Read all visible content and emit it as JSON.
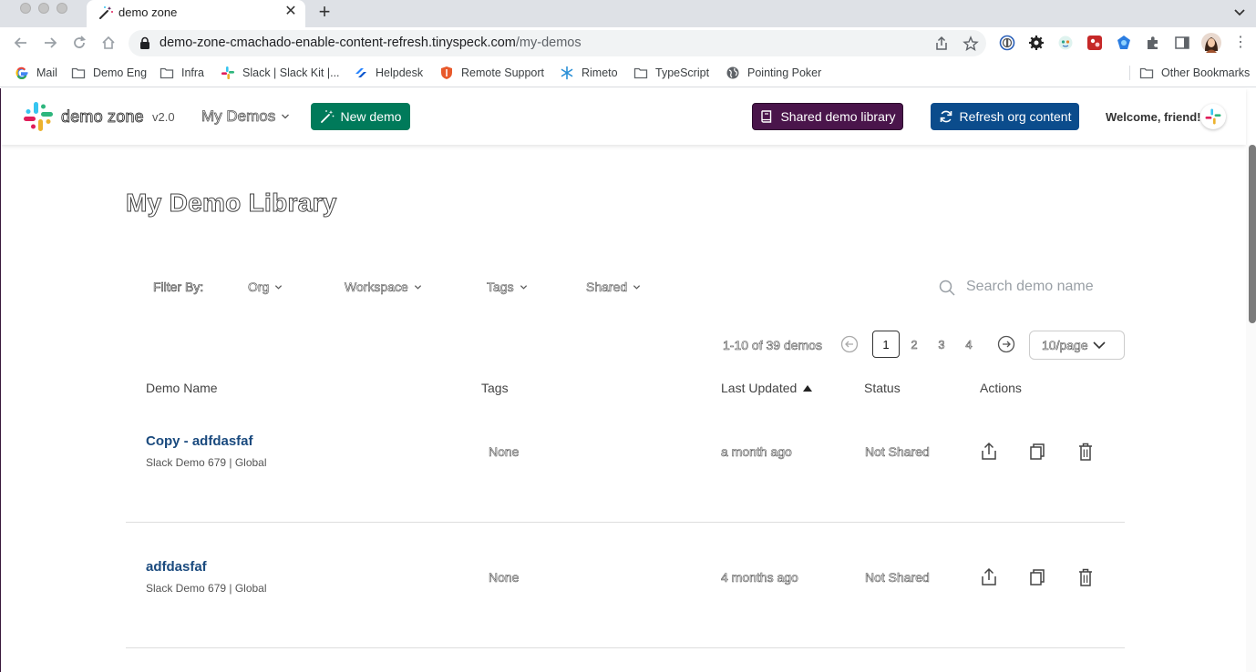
{
  "browser": {
    "tab_title": "demo zone",
    "url_domain": "demo-zone-cmachado-enable-content-refresh.tinyspeck.com",
    "url_path": "/my-demos",
    "bookmarks": [
      {
        "label": "Mail",
        "icon": "google-icon"
      },
      {
        "label": "Demo Eng",
        "icon": "folder-icon"
      },
      {
        "label": "Infra",
        "icon": "folder-icon"
      },
      {
        "label": "Slack | Slack Kit |...",
        "icon": "slack-icon"
      },
      {
        "label": "Helpdesk",
        "icon": "jira-icon"
      },
      {
        "label": "Remote Support",
        "icon": "shield-icon"
      },
      {
        "label": "Rimeto",
        "icon": "rimeto-icon"
      },
      {
        "label": "TypeScript",
        "icon": "folder-icon"
      },
      {
        "label": "Pointing Poker",
        "icon": "globe-icon"
      }
    ],
    "other_bookmarks": "Other Bookmarks"
  },
  "nav": {
    "brand": "demo zone",
    "version": "v2.0",
    "my_demos": "My Demos",
    "new_demo": "New demo",
    "shared_library": "Shared demo library",
    "refresh": "Refresh org content",
    "welcome": "Welcome, friend!"
  },
  "page": {
    "title": "My Demo Library",
    "filter_label": "Filter By:",
    "filters": [
      "Org",
      "Workspace",
      "Tags",
      "Shared"
    ],
    "search_placeholder": "Search demo name",
    "pagination": {
      "summary": "1-10 of 39 demos",
      "pages": [
        "1",
        "2",
        "3",
        "4"
      ],
      "current": "1",
      "page_size": "10/page"
    },
    "columns": [
      "Demo Name",
      "Tags",
      "Last Updated",
      "Status",
      "Actions"
    ],
    "rows": [
      {
        "name": "Copy - adfdasfaf",
        "sub": "Slack Demo 679 | Global",
        "tags": "None",
        "updated": "a month ago",
        "status": "Not Shared"
      },
      {
        "name": "adfdasfaf",
        "sub": "Slack Demo 679 | Global",
        "tags": "None",
        "updated": "4 months ago",
        "status": "Not Shared"
      }
    ]
  },
  "colors": {
    "new_demo": "#007a5a",
    "shared_library": "#4a154b",
    "refresh": "#0b4c8c",
    "demo_link": "#1a4a7e"
  }
}
